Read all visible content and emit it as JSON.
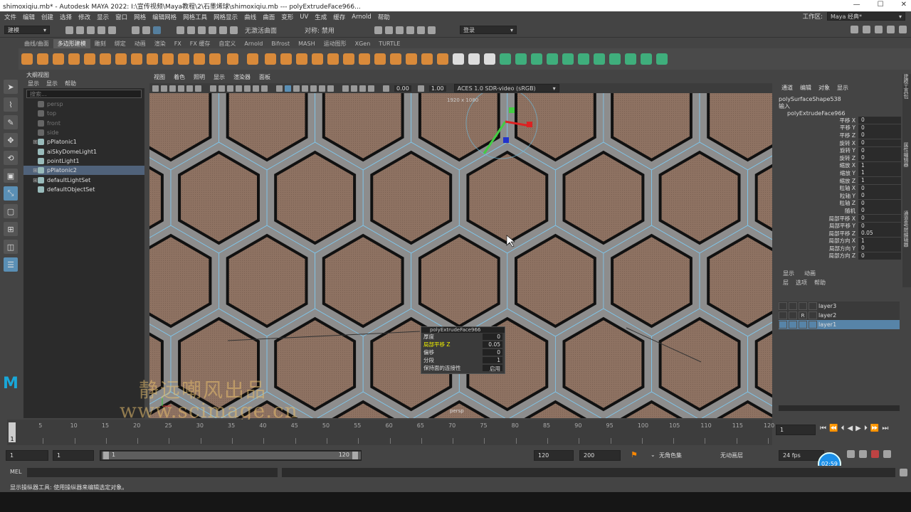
{
  "window": {
    "title": "shimoxiqiu.mb* - Autodesk MAYA 2022: I:\\宣传视频\\Maya教程\\2\\石墨烯球\\shimoxiqiu.mb  ---   polyExtrudeFace966...",
    "controls": [
      "—",
      "☐",
      "✕"
    ]
  },
  "menubar": {
    "items": [
      "文件",
      "编辑",
      "创建",
      "选择",
      "修改",
      "显示",
      "窗口",
      "网格",
      "编辑网格",
      "网格工具",
      "网格显示",
      "曲线",
      "曲面",
      "变形",
      "UV",
      "生成",
      "缓存",
      "Arnold",
      "帮助"
    ],
    "workspace_label": "工作区:",
    "workspace_value": "Maya 经典*"
  },
  "statusline": {
    "mode": "建模",
    "no_live_surface": "无激活曲面",
    "symmetry_label": "对称: 禁用",
    "login": "登录"
  },
  "shelf": {
    "tabs": [
      "曲线/曲面",
      "多边形建模",
      "雕刻",
      "绑定",
      "动画",
      "渲染",
      "FX",
      "FX 缓存",
      "自定义",
      "Arnold",
      "Bifrost",
      "MASH",
      "运动图形",
      "XGen",
      "TURTLE"
    ],
    "active_tab": 1
  },
  "outliner": {
    "title": "大纲视图",
    "menus": [
      "显示",
      "显示",
      "帮助"
    ],
    "search_placeholder": "搜索...",
    "items": [
      {
        "label": "persp",
        "dim": true,
        "expand": ""
      },
      {
        "label": "top",
        "dim": true,
        "expand": ""
      },
      {
        "label": "front",
        "dim": true,
        "expand": ""
      },
      {
        "label": "side",
        "dim": true,
        "expand": ""
      },
      {
        "label": "pPlatonic1",
        "dim": false,
        "expand": "⊞"
      },
      {
        "label": "aiSkyDomeLight1",
        "dim": false,
        "expand": ""
      },
      {
        "label": "pointLight1",
        "dim": false,
        "expand": ""
      },
      {
        "label": "pPlatonic2",
        "dim": false,
        "expand": "⊞",
        "selected": true
      },
      {
        "label": "defaultLightSet",
        "dim": false,
        "expand": "⊞"
      },
      {
        "label": "defaultObjectSet",
        "dim": false,
        "expand": ""
      }
    ]
  },
  "viewport": {
    "menus": [
      "视图",
      "着色",
      "照明",
      "显示",
      "渲染器",
      "面板"
    ],
    "value_a": "0.00",
    "value_b": "1.00",
    "color_space": "ACES 1.0 SDR-video (sRGB)",
    "resolution": "1920 x 1080",
    "camera": "persp"
  },
  "dialog": {
    "title": "polyExtrudeFace966",
    "rows": [
      {
        "label": "厚度",
        "value": "0"
      },
      {
        "label": "局部平移 Z",
        "value": "0.05",
        "highlight": true
      },
      {
        "label": "偏移",
        "value": "0"
      },
      {
        "label": "分段",
        "value": "1"
      },
      {
        "label": "保持面的连接性",
        "value": "启用"
      }
    ]
  },
  "channel_box": {
    "tabs": [
      "通道",
      "编辑",
      "对象",
      "显示"
    ],
    "shape": "polySurfaceShape538",
    "inputs_label": "输入",
    "node": "polyExtrudeFace966",
    "rows": [
      {
        "label": "平移 X",
        "value": "0"
      },
      {
        "label": "平移 Y",
        "value": "0"
      },
      {
        "label": "平移 Z",
        "value": "0"
      },
      {
        "label": "旋转 X",
        "value": "0"
      },
      {
        "label": "旋转 Y",
        "value": "0"
      },
      {
        "label": "旋转 Z",
        "value": "0"
      },
      {
        "label": "缩放 X",
        "value": "1"
      },
      {
        "label": "缩放 Y",
        "value": "1"
      },
      {
        "label": "缩放 Z",
        "value": "1"
      },
      {
        "label": "粒轴 X",
        "value": "0"
      },
      {
        "label": "粒轴 Y",
        "value": "0"
      },
      {
        "label": "粒轴 Z",
        "value": "0"
      },
      {
        "label": "随机",
        "value": "0"
      },
      {
        "label": "局部平移 X",
        "value": "0"
      },
      {
        "label": "局部平移 Y",
        "value": "0"
      },
      {
        "label": "局部平移 Z",
        "value": "0.05"
      },
      {
        "label": "局部方向 X",
        "value": "1"
      },
      {
        "label": "局部方向 Y",
        "value": "0"
      },
      {
        "label": "局部方向 Z",
        "value": "0"
      }
    ]
  },
  "layer_editor": {
    "tabs": [
      "显示",
      "动画"
    ],
    "menus": [
      "层",
      "选项",
      "帮助"
    ],
    "layers": [
      {
        "name": "layer3",
        "r": ""
      },
      {
        "name": "layer2",
        "r": "R"
      },
      {
        "name": "layer1",
        "r": "",
        "selected": true
      }
    ]
  },
  "side_tabs": [
    "建模工具包",
    "属性编辑器",
    "通道盒/层编辑器"
  ],
  "timeline": {
    "ticks": [
      "5",
      "10",
      "15",
      "20",
      "25",
      "30",
      "35",
      "40",
      "45",
      "50",
      "55",
      "60",
      "65",
      "70",
      "75",
      "80",
      "85",
      "90",
      "95",
      "100",
      "105",
      "110",
      "115",
      "120"
    ],
    "current_frame_marker": "1",
    "current_frame": "1"
  },
  "range": {
    "start": "1",
    "playback_start": "1",
    "slider_start": "1",
    "slider_end": "120",
    "playback_end": "120",
    "end": "200",
    "character_set": "无角色集",
    "anim_layer": "无动画层",
    "fps": "24 fps"
  },
  "mel": {
    "label": "MEL"
  },
  "help_line": "显示操纵器工具: 使用操纵器来编辑选定对象。",
  "watermark": {
    "line1": "静远嘲风出品",
    "line2": "www.scimage.cn"
  },
  "clock": "02:59",
  "colors": {
    "accent": "#5a8fb5",
    "selection": "#5784a8",
    "viewport_bg": "#878787",
    "face": "#8b6d5c",
    "wire": "#7fc8ee"
  }
}
